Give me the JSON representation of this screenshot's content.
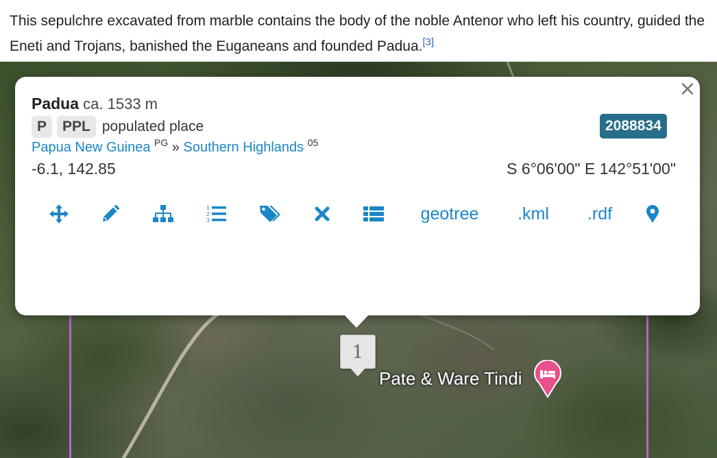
{
  "article": {
    "quote_text": "This sepulchre excavated from marble contains the body of the noble Antenor who left his country, guided the Eneti and Trojans, banished the Euganeans and founded Padua.",
    "reference": "[3]"
  },
  "popup": {
    "name": "Padua",
    "elevation": "ca. 1533 m",
    "feature_class": "P",
    "feature_code": "PPL",
    "feature_code_name": "populated place",
    "geonameid": "2088834",
    "country": "Papua New Guinea",
    "country_code": "PG",
    "separator": "»",
    "admin1": "Southern Highlands",
    "admin1_code": "05",
    "coords_decimal": "-6.1, 142.85",
    "coords_dms": "S 6°06'00\" E 142°51'00\"",
    "close_label": "×",
    "toolbar": {
      "move_icon": "arrows-move-icon",
      "edit_icon": "pencil-icon",
      "hierarchy_icon": "sitemap-icon",
      "list_icon": "ordered-list-icon",
      "tags_icon": "tags-icon",
      "delete_icon": "times-icon",
      "details_icon": "list-icon",
      "geotree_label": "geotree",
      "kml_label": ".kml",
      "rdf_label": ".rdf",
      "locate_icon": "map-marker-icon"
    }
  },
  "map": {
    "cluster_count": "1",
    "poi_label": "Pate & Ware Tindi",
    "poi_icon": "hotel-bed-icon",
    "colors": {
      "boundary": "#b466cf",
      "poi_pin": "#e8508e",
      "link": "#1a86c7",
      "geoid_badge": "#276e8a"
    }
  }
}
